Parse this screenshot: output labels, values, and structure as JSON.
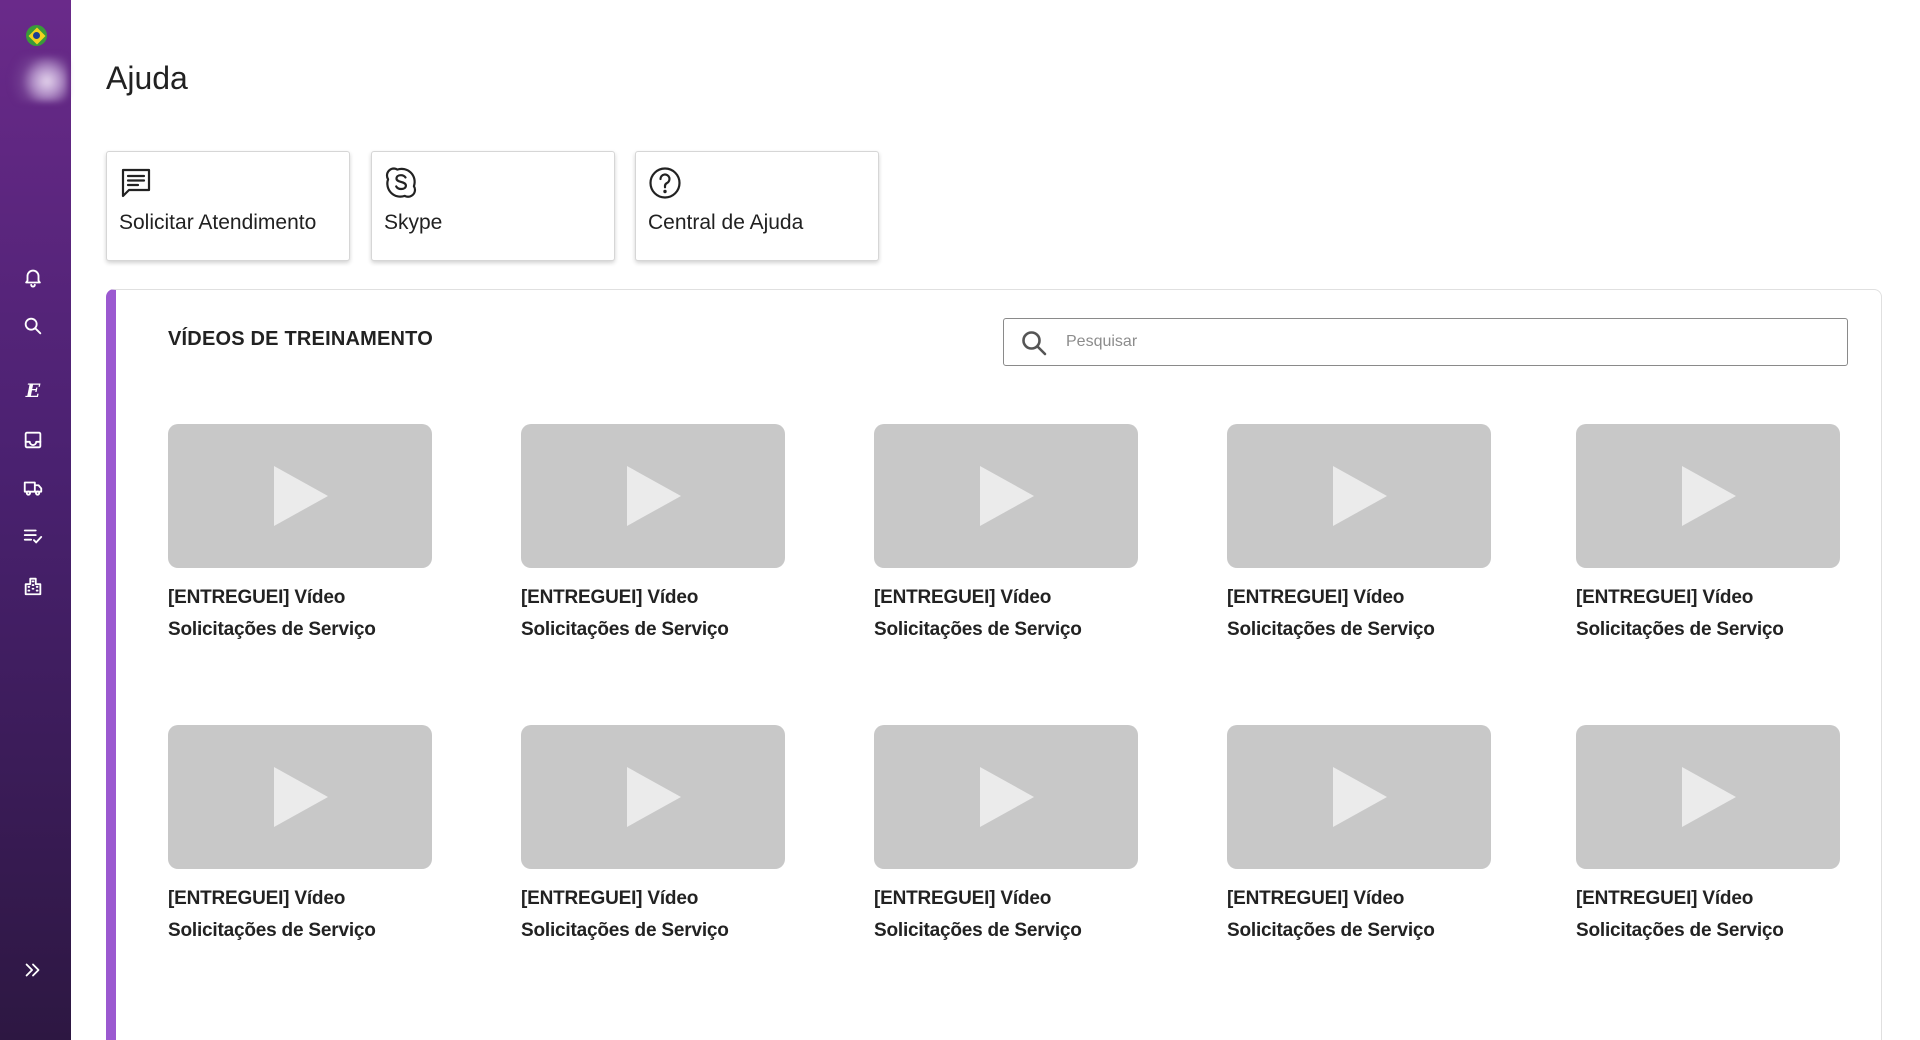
{
  "app": {
    "page_title": "Ajuda"
  },
  "sidebar": {
    "flag": "brazil-flag",
    "items": [
      {
        "name": "notifications",
        "icon": "bell-icon"
      },
      {
        "name": "search",
        "icon": "search-icon"
      },
      {
        "name": "e-module",
        "icon": "letter-e-icon",
        "glyph": "E"
      },
      {
        "name": "inbox",
        "icon": "inbox-icon"
      },
      {
        "name": "delivery",
        "icon": "truck-icon"
      },
      {
        "name": "checklist",
        "icon": "checklist-icon"
      },
      {
        "name": "company",
        "icon": "building-icon"
      }
    ],
    "expand_icon": "double-chevron-right-icon"
  },
  "help_cards": [
    {
      "label": "Solicitar Atendimento",
      "icon": "chat-icon"
    },
    {
      "label": "Skype",
      "icon": "skype-icon"
    },
    {
      "label": "Central de Ajuda",
      "icon": "help-circle-icon"
    }
  ],
  "videos_section": {
    "title": "VÍDEOS DE TREINAMENTO",
    "search_placeholder": "Pesquisar",
    "videos": [
      {
        "line1": "[ENTREGUEI] Vídeo",
        "line2": "Solicitações de Serviço"
      },
      {
        "line1": "[ENTREGUEI] Vídeo",
        "line2": "Solicitações de Serviço"
      },
      {
        "line1": "[ENTREGUEI] Vídeo",
        "line2": "Solicitações de Serviço"
      },
      {
        "line1": "[ENTREGUEI] Vídeo",
        "line2": "Solicitações de Serviço"
      },
      {
        "line1": "[ENTREGUEI] Vídeo",
        "line2": "Solicitações de Serviço"
      },
      {
        "line1": "[ENTREGUEI] Vídeo",
        "line2": "Solicitações de Serviço"
      },
      {
        "line1": "[ENTREGUEI] Vídeo",
        "line2": "Solicitações de Serviço"
      },
      {
        "line1": "[ENTREGUEI] Vídeo",
        "line2": "Solicitações de Serviço"
      },
      {
        "line1": "[ENTREGUEI] Vídeo",
        "line2": "Solicitações de Serviço"
      },
      {
        "line1": "[ENTREGUEI] Vídeo",
        "line2": "Solicitações de Serviço"
      }
    ]
  },
  "colors": {
    "sidebar_top": "#6a2a8a",
    "sidebar_bottom": "#2d1742",
    "accent": "#9b59d0",
    "thumbnail": "#c8c8c8"
  }
}
